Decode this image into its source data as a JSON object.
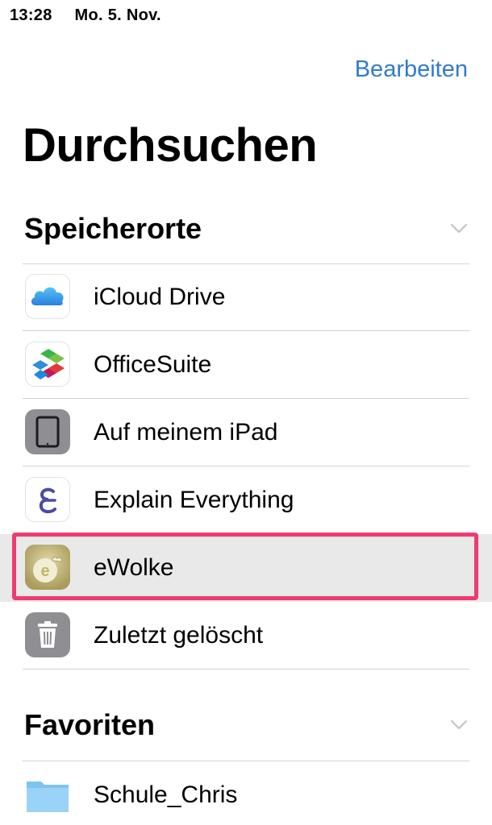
{
  "status_bar": {
    "time": "13:28",
    "date": "Mo. 5. Nov."
  },
  "header": {
    "edit_label": "Bearbeiten",
    "title": "Durchsuchen"
  },
  "locations": {
    "title": "Speicherorte",
    "items": [
      {
        "label": "iCloud Drive",
        "icon": "icloud-icon"
      },
      {
        "label": "OfficeSuite",
        "icon": "officesuite-icon"
      },
      {
        "label": "Auf meinem iPad",
        "icon": "ipad-icon"
      },
      {
        "label": "Explain Everything",
        "icon": "explain-everything-icon"
      },
      {
        "label": "eWolke",
        "icon": "ewolke-icon",
        "selected": true
      },
      {
        "label": "Zuletzt gelöscht",
        "icon": "trash-icon"
      }
    ]
  },
  "favorites": {
    "title": "Favoriten",
    "items": [
      {
        "label": "Schule_Chris",
        "icon": "folder-icon"
      }
    ]
  },
  "colors": {
    "accent": "#2f7bd0",
    "highlight_border": "#f03a72",
    "selected_row": "#e9e9ea"
  }
}
